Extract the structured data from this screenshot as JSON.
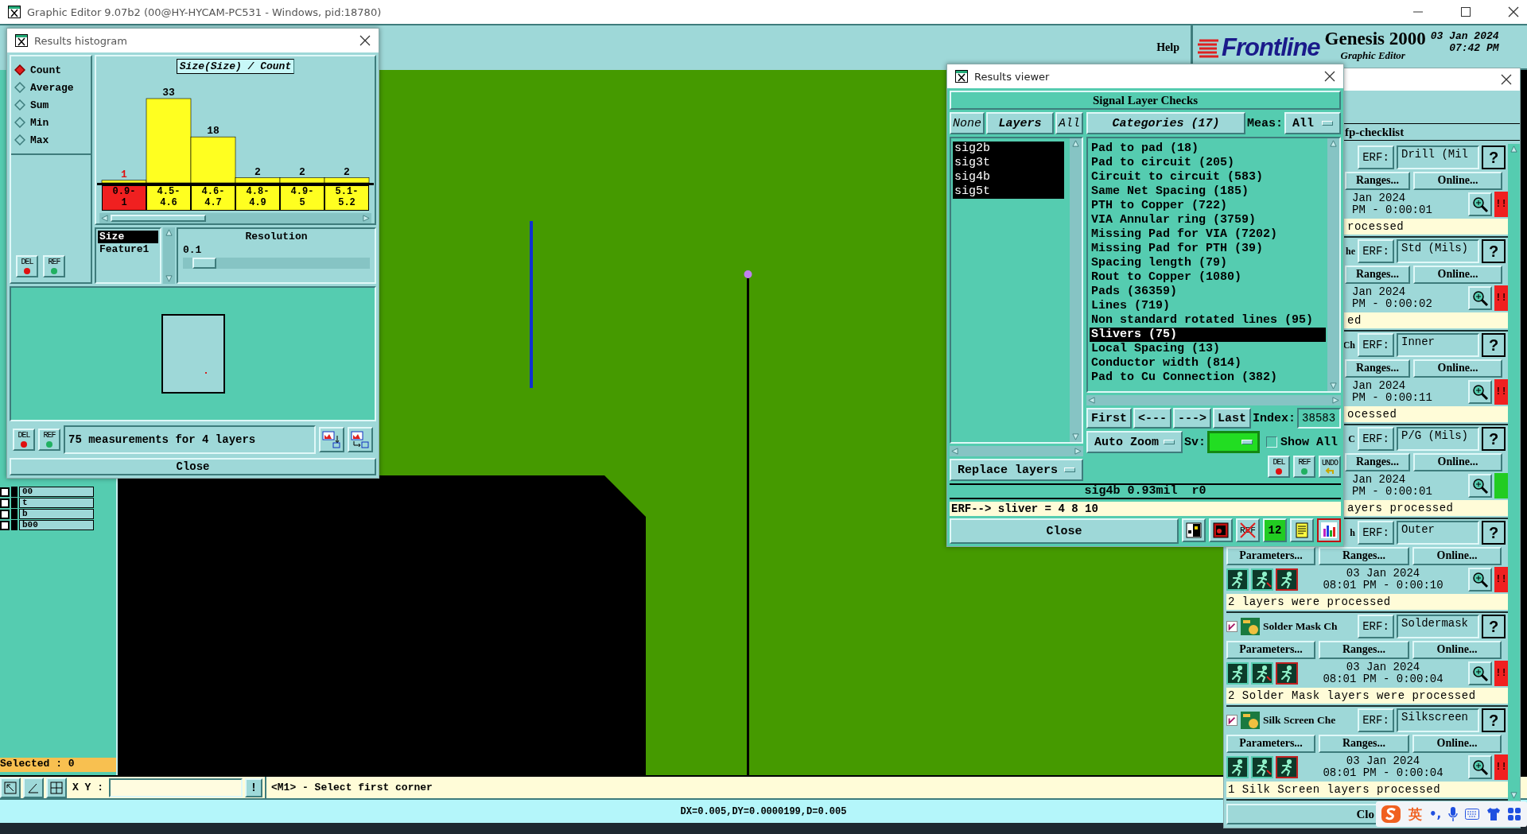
{
  "window": {
    "title": "Graphic Editor 9.07b2 (00@HY-HYCAM-PC531 - Windows, pid:18780)"
  },
  "menu": {
    "items": [
      "Help"
    ]
  },
  "brand": {
    "logo": "Frontline",
    "product": "Genesis 2000",
    "subtitle": "Graphic Editor",
    "date": "03 Jan 2024",
    "time": "07:42 PM"
  },
  "layer_panel": {
    "layers": [
      {
        "name": "00",
        "checked": false
      },
      {
        "name": "t",
        "checked": false
      },
      {
        "name": "b",
        "checked": false
      },
      {
        "name": "b00",
        "checked": false
      }
    ],
    "selected_count": "Selected : 0"
  },
  "command_bar": {
    "coord_label": "X Y :",
    "alert": "!",
    "prompt": "<M1> - Select first corner"
  },
  "status_bar": {
    "text": "DX=0.005,DY=0.0000199,D=0.005"
  },
  "histogram": {
    "title": "Results histogram",
    "modes": [
      {
        "label": "Count",
        "selected": true
      },
      {
        "label": "Average",
        "selected": false
      },
      {
        "label": "Sum",
        "selected": false
      },
      {
        "label": "Min",
        "selected": false
      },
      {
        "label": "Max",
        "selected": false
      }
    ],
    "tools": [
      {
        "kind": "delete",
        "label": "DEL"
      },
      {
        "kind": "refresh",
        "label": "REF"
      }
    ],
    "chart_data": {
      "type": "bar",
      "title": "Size(Size) / Count",
      "categories": [
        "0.9-\n1",
        "4.5-\n4.6",
        "4.6-\n4.7",
        "4.8-\n4.9",
        "4.9-\n5",
        "5.1-\n5.2"
      ],
      "values": [
        1,
        33,
        18,
        2,
        2,
        2
      ],
      "data_labels": true
    },
    "bins": [
      {
        "selected": true
      },
      {
        "selected": false
      },
      {
        "selected": false
      },
      {
        "selected": false
      },
      {
        "selected": false
      },
      {
        "selected": false
      }
    ],
    "fields": [
      {
        "label": "Size",
        "selected": true
      },
      {
        "label": "Feature1",
        "selected": false
      }
    ],
    "resolution": {
      "label": "Resolution",
      "value": "0.1",
      "level": 0.05
    },
    "summary_tools": [
      {
        "kind": "delete",
        "label": "DEL"
      },
      {
        "kind": "refresh",
        "label": "REF"
      }
    ],
    "summary": "75 measurements for 4 layers",
    "close": "Close"
  },
  "viewer": {
    "title": "Results viewer",
    "heading": "Signal Layer Checks",
    "layer_buttons": [
      {
        "label": "None",
        "kind": "plain"
      },
      {
        "label": "Layers",
        "kind": "header"
      },
      {
        "label": "All",
        "kind": "plain"
      }
    ],
    "categories_header": "Categories (17)",
    "meas_label": "Meas:",
    "meas_value": "All",
    "layers": [
      {
        "name": "sig2b",
        "selected": true
      },
      {
        "name": "sig3t",
        "selected": true
      },
      {
        "name": "sig4b",
        "selected": true
      },
      {
        "name": "sig5t",
        "selected": true
      }
    ],
    "layer_action": "Replace layers",
    "categories": [
      {
        "label": "Pad to pad (18)",
        "selected": false
      },
      {
        "label": "Pad to circuit (205)",
        "selected": false
      },
      {
        "label": "Circuit to circuit (583)",
        "selected": false
      },
      {
        "label": "Same Net Spacing (185)",
        "selected": false
      },
      {
        "label": "PTH to Copper (722)",
        "selected": false
      },
      {
        "label": "VIA Annular ring (3759)",
        "selected": false
      },
      {
        "label": "Missing Pad for VIA (7202)",
        "selected": false
      },
      {
        "label": "Missing Pad for PTH (39)",
        "selected": false
      },
      {
        "label": "Spacing length (79)",
        "selected": false
      },
      {
        "label": "Rout to Copper (1080)",
        "selected": false
      },
      {
        "label": "Pads (36359)",
        "selected": false
      },
      {
        "label": "Lines (719)",
        "selected": false
      },
      {
        "label": "Non standard rotated lines (95)",
        "selected": false
      },
      {
        "label": "Slivers (75)",
        "selected": true
      },
      {
        "label": "Local Spacing (13)",
        "selected": false
      },
      {
        "label": "Conductor width (814)",
        "selected": false
      },
      {
        "label": "Pad to Cu Connection (382)",
        "selected": false
      }
    ],
    "nav": [
      "First",
      "<---",
      "--->",
      "Last"
    ],
    "index_label": "Index:",
    "index_value": "38583",
    "zoom_mode": "Auto Zoom",
    "sv_label": "Sv:",
    "show_all": {
      "label": "Show All",
      "checked": false
    },
    "tools": [
      {
        "kind": "delete",
        "label": "DEL"
      },
      {
        "kind": "refresh",
        "label": "REF"
      },
      {
        "kind": "undo",
        "label": "UNDO"
      }
    ],
    "measurement": "sig4b 0.93mil  r0",
    "erf_line": "ERF--> sliver = 4 8 10",
    "close": "Close",
    "bottom_tools": [
      {
        "kind": "highlight"
      },
      {
        "kind": "marker"
      },
      {
        "kind": "ref-off",
        "label": "REF"
      },
      {
        "kind": "count",
        "label": "12"
      },
      {
        "kind": "report"
      },
      {
        "kind": "histogram",
        "selected": true
      }
    ]
  },
  "checklist": {
    "title": "fp-checklist",
    "sections": [
      {
        "kind": "clipped",
        "erf_label": "ERF:",
        "erf": "Drill (Mil",
        "help": "?",
        "buttons": [
          "Ranges...",
          "Online..."
        ],
        "date": "Jan 2024",
        "duration": "PM - 0:00:01",
        "passed": false,
        "flag": "!!",
        "message": "rocessed"
      },
      {
        "kind": "clipped",
        "label": "he",
        "erf_label": "ERF:",
        "erf": "Std (Mils)",
        "help": "?",
        "buttons": [
          "Ranges...",
          "Online..."
        ],
        "date": "Jan 2024",
        "duration": "PM - 0:00:02",
        "passed": false,
        "flag": "!!",
        "message": "ed"
      },
      {
        "kind": "clipped",
        "label": "Ch",
        "erf_label": "ERF:",
        "erf": "Inner",
        "help": "?",
        "buttons": [
          "Ranges...",
          "Online..."
        ],
        "date": "Jan 2024",
        "duration": "PM - 0:00:11",
        "passed": false,
        "flag": "!!",
        "message": "ocessed"
      },
      {
        "kind": "clipped",
        "label": "C",
        "erf_label": "ERF:",
        "erf": "P/G (Mils)",
        "help": "?",
        "buttons": [
          "Ranges...",
          "Online..."
        ],
        "date": "Jan 2024",
        "duration": "PM - 0:00:01",
        "passed": true,
        "message": "ayers processed"
      },
      {
        "kind": "head-clipped",
        "label": "h",
        "erf_label": "ERF:",
        "erf": "Outer",
        "help": "?",
        "buttons": [
          "Parameters...",
          "Ranges...",
          "Online..."
        ],
        "date": "03 Jan 2024",
        "duration": "08:01 PM - 0:00:10",
        "passed": false,
        "flag": "!!",
        "message": "2 layers were processed"
      },
      {
        "kind": "full",
        "checked": true,
        "label": "Solder Mask Ch",
        "erf_label": "ERF:",
        "erf": "Soldermask",
        "help": "?",
        "buttons": [
          "Parameters...",
          "Ranges...",
          "Online..."
        ],
        "date": "03 Jan 2024",
        "duration": "08:01 PM - 0:00:04",
        "passed": false,
        "flag": "!!",
        "message": "2 Solder Mask layers were processed"
      },
      {
        "kind": "full",
        "checked": true,
        "label": "Silk Screen Che",
        "erf_label": "ERF:",
        "erf": "Silkscreen",
        "help": "?",
        "buttons": [
          "Parameters...",
          "Ranges...",
          "Online..."
        ],
        "date": "03 Jan 2024",
        "duration": "08:01 PM - 0:00:04",
        "passed": false,
        "flag": "!!",
        "message": "1 Silk Screen layers processed"
      }
    ],
    "close": "Clo"
  },
  "input_method": {
    "language": "英",
    "punctuation": "•,"
  }
}
